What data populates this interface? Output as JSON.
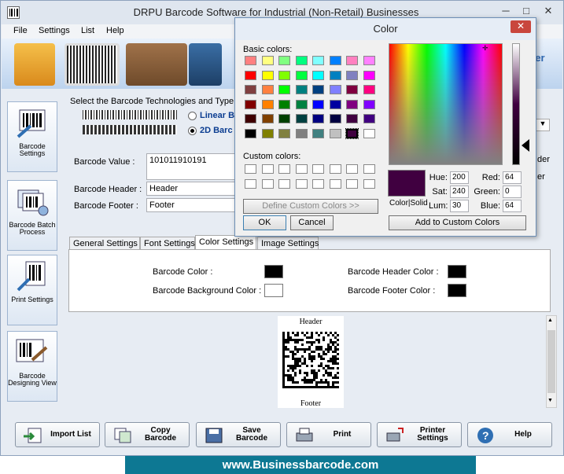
{
  "window": {
    "title": "DRPU Barcode Software for Industrial (Non-Retail) Businesses",
    "minimize": "─",
    "maximize": "□",
    "close": "✕"
  },
  "menu": [
    "File",
    "Settings",
    "List",
    "Help"
  ],
  "banner": {
    "brand_text": "ker"
  },
  "sidebar": [
    {
      "label": "Barcode Settings"
    },
    {
      "label": "Barcode Batch Process"
    },
    {
      "label": "Print Settings"
    },
    {
      "label": "Barcode Designing View"
    }
  ],
  "technology": {
    "heading": "Select the Barcode Technologies and Type",
    "linear_label": "Linear B",
    "twod_label": "2D Barc",
    "selected": "2D"
  },
  "fields": {
    "value_label": "Barcode Value :",
    "value": "101011910191",
    "header_label": "Barcode Header :",
    "header": "Header",
    "footer_label": "Barcode Footer :",
    "footer": "Footer"
  },
  "right_partial": {
    "a": "der",
    "b": "er"
  },
  "tabs": [
    "General Settings",
    "Font Settings",
    "Color Settings",
    "Image Settings"
  ],
  "active_tab": 2,
  "color_settings": {
    "barcode_color_label": "Barcode Color :",
    "barcode_color": "#000000",
    "background_color_label": "Barcode Background Color :",
    "background_color": "#ffffff",
    "header_color_label": "Barcode Header Color :",
    "header_color": "#000000",
    "footer_color_label": "Barcode Footer Color :",
    "footer_color": "#000000"
  },
  "preview": {
    "header": "Header",
    "footer": "Footer"
  },
  "buttons": [
    "Import List",
    "Copy Barcode",
    "Save Barcode",
    "Print",
    "Printer Settings",
    "Help"
  ],
  "footer_url": "www.Businessbarcode.com",
  "color_dialog": {
    "title": "Color",
    "close": "✕",
    "basic_label": "Basic colors:",
    "basic_colors": [
      "#ff8080",
      "#ffff80",
      "#80ff80",
      "#00ff80",
      "#80ffff",
      "#0080ff",
      "#ff80c0",
      "#ff80ff",
      "#ff0000",
      "#ffff00",
      "#80ff00",
      "#00ff40",
      "#00ffff",
      "#0080c0",
      "#8080c0",
      "#ff00ff",
      "#804040",
      "#ff8040",
      "#00ff00",
      "#008080",
      "#004080",
      "#8080ff",
      "#800040",
      "#ff0080",
      "#800000",
      "#ff8000",
      "#008000",
      "#008040",
      "#0000ff",
      "#0000a0",
      "#800080",
      "#8000ff",
      "#400000",
      "#804000",
      "#004000",
      "#004040",
      "#000080",
      "#000040",
      "#400040",
      "#400080",
      "#000000",
      "#808000",
      "#808040",
      "#808080",
      "#408080",
      "#c0c0c0",
      "#400040",
      "#ffffff"
    ],
    "selected_index": 46,
    "custom_label": "Custom colors:",
    "define_label": "Define Custom Colors >>",
    "ok": "OK",
    "cancel": "Cancel",
    "color_solid_label": "Color|Solid",
    "hue_label": "Hue:",
    "hue": "200",
    "sat_label": "Sat:",
    "sat": "240",
    "lum_label": "Lum:",
    "lum": "30",
    "red_label": "Red:",
    "red": "64",
    "green_label": "Green:",
    "green": "0",
    "blue_label": "Blue:",
    "blue": "64",
    "add_custom": "Add to Custom Colors",
    "current_color": "#400040"
  }
}
